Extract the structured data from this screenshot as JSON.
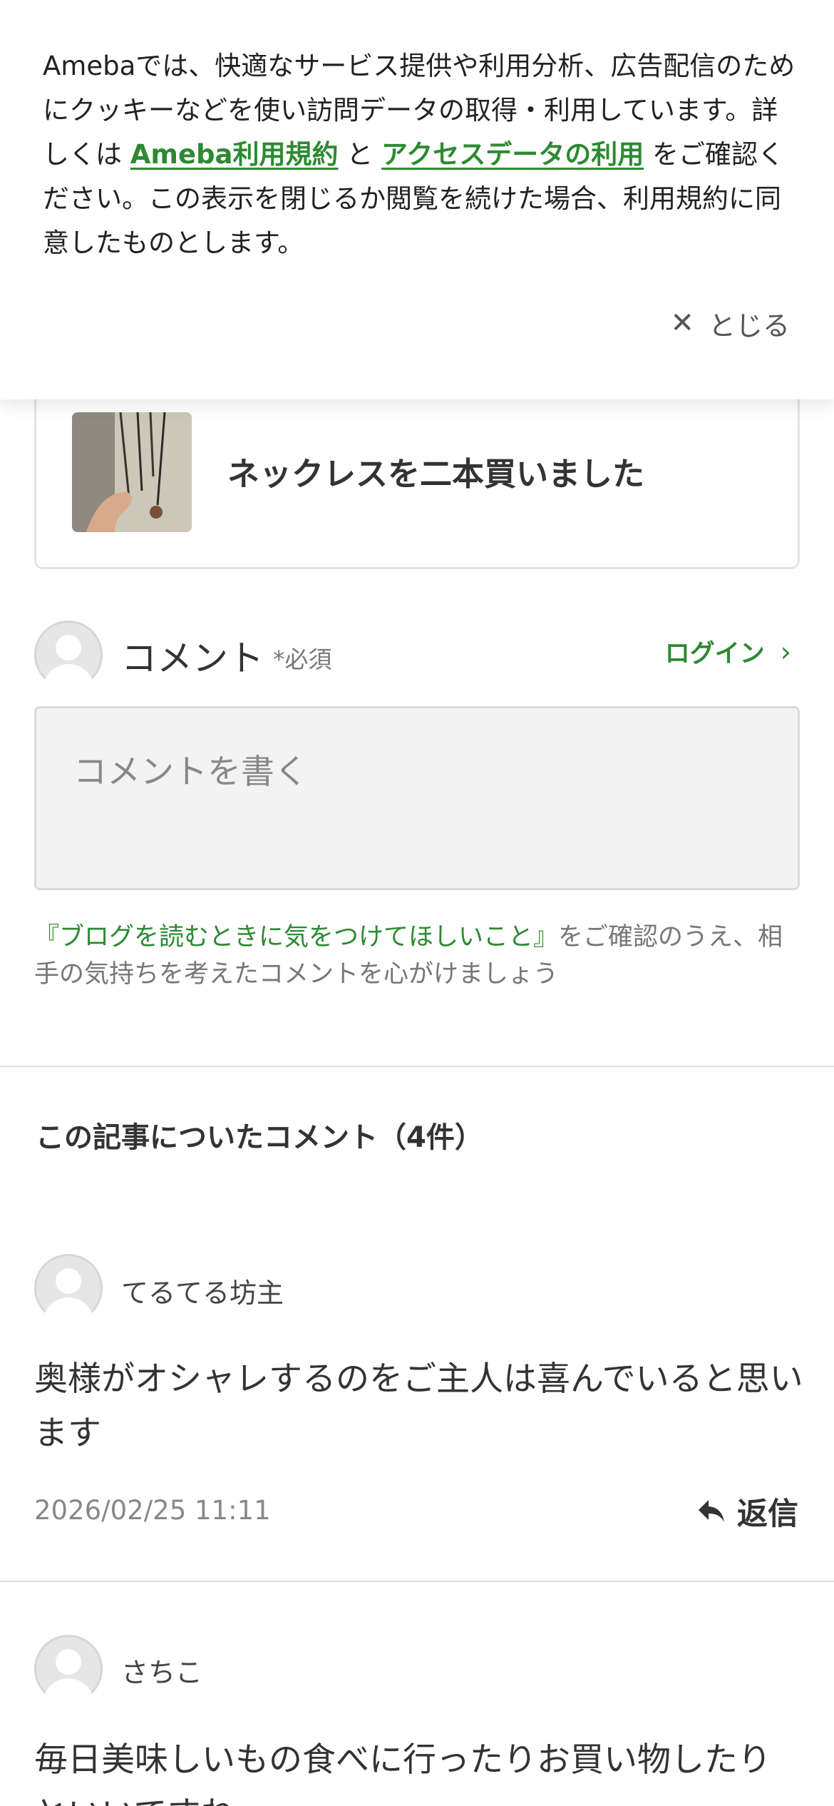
{
  "cookie_banner": {
    "text_before": "Amebaでは、快適なサービス提供や利用分析、広告配信のためにクッキーなどを使い訪問データの取得・利用しています。詳しくは ",
    "link_terms": "Ameba利用規約",
    "text_and": " と ",
    "link_access": "アクセスデータの利用",
    "text_after": " をご確認ください。この表示を閉じるか閲覧を続けた場合、利用規約に同意したものとします。",
    "close_label": "とじる",
    "link_color": "#2d8a32"
  },
  "related_article": {
    "title": "ネックレスを二本買いました"
  },
  "comment_form": {
    "label": "コメント",
    "required": "*必須",
    "login_label": "ログイン",
    "placeholder": "コメントを書く",
    "notice_link": "『ブログを読むときに気をつけてほしいこと』",
    "notice_text": "をご確認のうえ、相手の気持ちを考えたコメントを心がけましょう"
  },
  "comments_section": {
    "title": "この記事についたコメント（4件）",
    "reply_label": "返信",
    "items": [
      {
        "author": "てるてる坊主",
        "body": "奥様がオシャレするのをご主人は喜んでいると思います",
        "date": "2026/02/25 11:11"
      },
      {
        "author": "さちこ",
        "body": "毎日美味しいもの食べに行ったりお買い物したりといいですね"
      }
    ]
  }
}
